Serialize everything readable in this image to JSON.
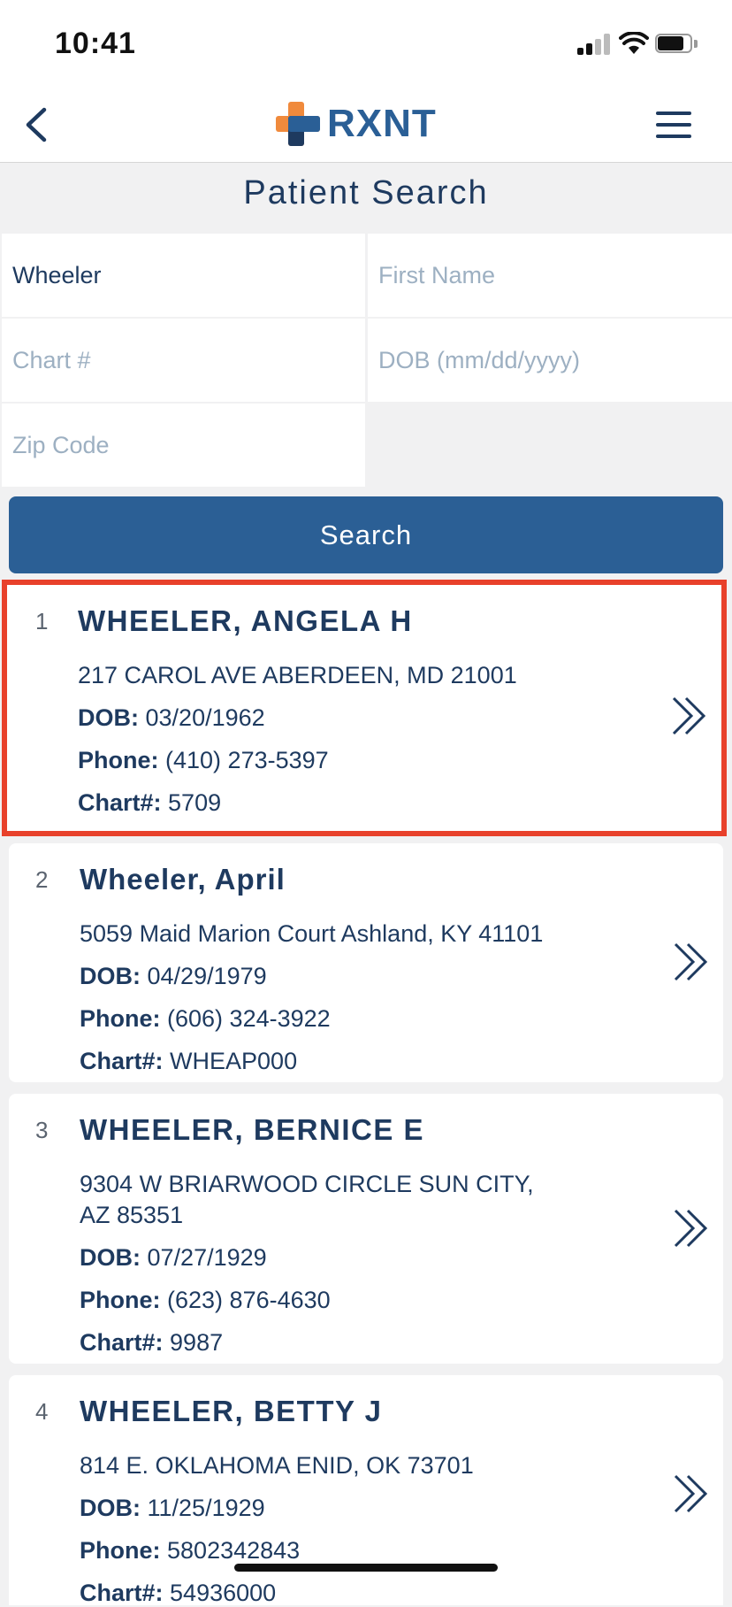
{
  "status_bar": {
    "time": "10:41"
  },
  "header": {
    "logo_text": "RXNT"
  },
  "page": {
    "title": "Patient Search"
  },
  "form": {
    "last_name_value": "Wheeler",
    "first_name_placeholder": "First Name",
    "chart_placeholder": "Chart #",
    "dob_placeholder": "DOB (mm/dd/yyyy)",
    "zip_placeholder": "Zip Code",
    "search_label": "Search"
  },
  "labels": {
    "dob": "DOB:",
    "phone": "Phone:",
    "chart": "Chart#:"
  },
  "results": [
    {
      "index": "1",
      "name": "WHEELER, ANGELA H",
      "address": "217 CAROL AVE ABERDEEN, MD 21001",
      "dob": "03/20/1962",
      "phone": "(410) 273-5397",
      "chart": "5709",
      "selected": true
    },
    {
      "index": "2",
      "name": "Wheeler, April",
      "address": "5059 Maid Marion Court Ashland, KY 41101",
      "dob": "04/29/1979",
      "phone": "(606) 324-3922",
      "chart": "WHEAP000",
      "selected": false
    },
    {
      "index": "3",
      "name": "WHEELER, BERNICE E",
      "address_line1": "9304 W BRIARWOOD CIRCLE SUN CITY,",
      "address_line2": "AZ 85351",
      "dob": "07/27/1929",
      "phone": "(623) 876-4630",
      "chart": "9987",
      "selected": false
    },
    {
      "index": "4",
      "name": "WHEELER, BETTY J",
      "address": "814 E. OKLAHOMA ENID, OK 73701",
      "dob": "11/25/1929",
      "phone": "5802342843",
      "chart": "54936000",
      "selected": false
    }
  ],
  "colors": {
    "accent": "#2b5f95",
    "selection": "#e8412b",
    "logo_orange": "#f08a3c",
    "text": "#1e3a5f"
  }
}
